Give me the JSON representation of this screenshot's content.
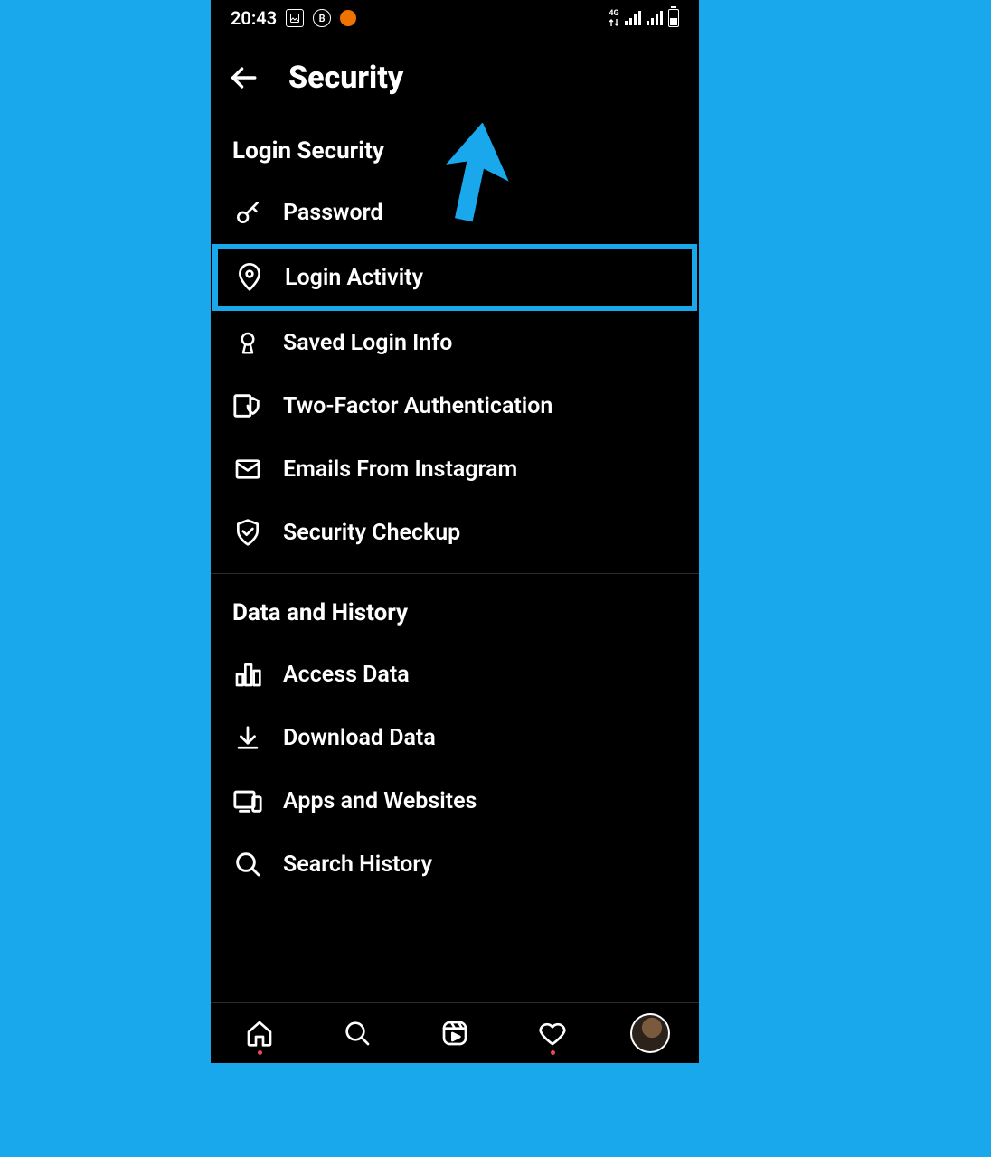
{
  "statusbar": {
    "time": "20:43",
    "net_label": "4G"
  },
  "header": {
    "title": "Security"
  },
  "sections": [
    {
      "title": "Login Security",
      "items": [
        {
          "label": "Password"
        },
        {
          "label": "Login Activity"
        },
        {
          "label": "Saved Login Info"
        },
        {
          "label": "Two-Factor Authentication"
        },
        {
          "label": "Emails From Instagram"
        },
        {
          "label": "Security Checkup"
        }
      ]
    },
    {
      "title": "Data and History",
      "items": [
        {
          "label": "Access Data"
        },
        {
          "label": "Download Data"
        },
        {
          "label": "Apps and Websites"
        },
        {
          "label": "Search History"
        }
      ]
    }
  ],
  "highlight": {
    "color": "#1aa8ed",
    "target_label": "Login Activity"
  }
}
